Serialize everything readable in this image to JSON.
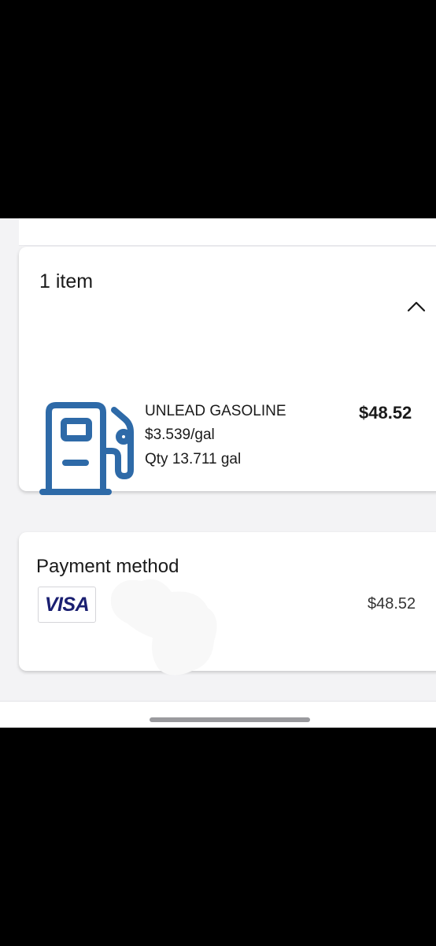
{
  "items_section": {
    "title": "1 item",
    "toggle_icon": "chevron-up-icon",
    "items": [
      {
        "icon": "fuel-pump-icon",
        "name": "UNLEAD GASOLINE",
        "unit_price": "$3.539/gal",
        "quantity": "Qty 13.711 gal",
        "total": "$48.52"
      }
    ]
  },
  "payment_section": {
    "title": "Payment method",
    "card_brand": "VISA",
    "amount": "$48.52"
  },
  "colors": {
    "icon_blue": "#2e6aa8",
    "visa_navy": "#1a1f71"
  }
}
